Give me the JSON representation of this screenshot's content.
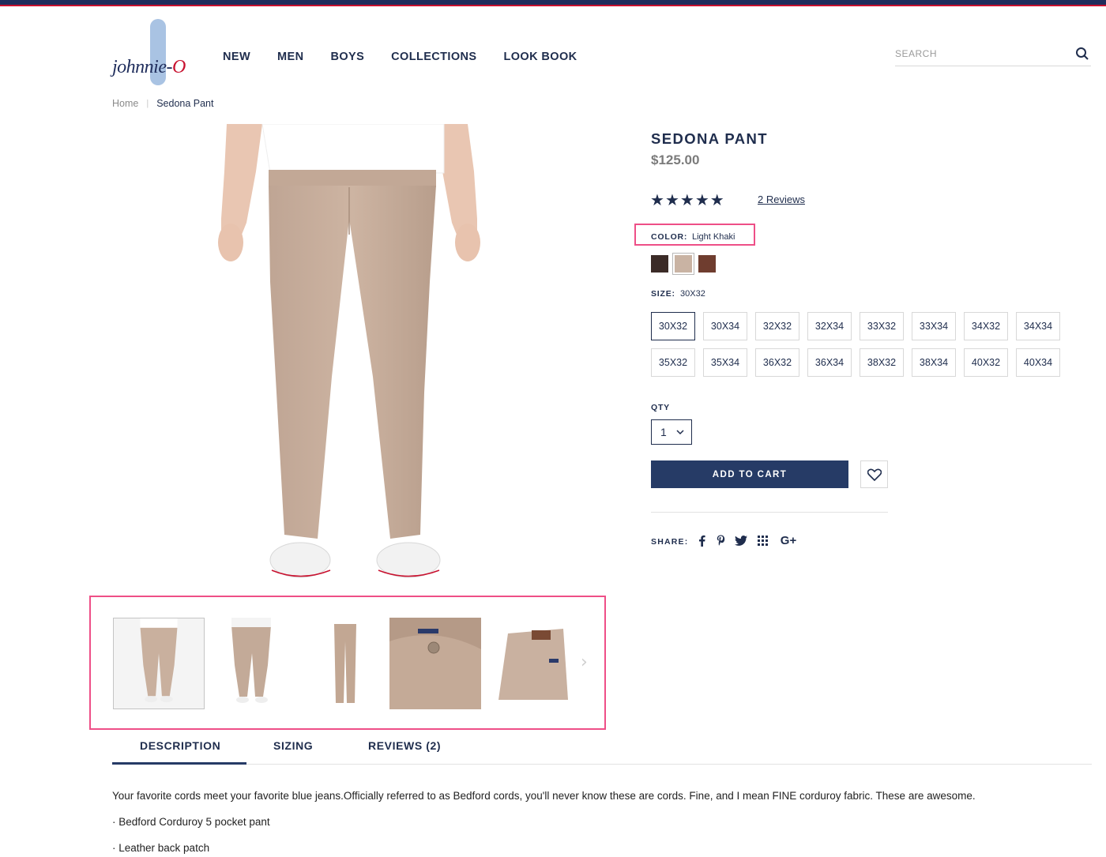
{
  "brand": {
    "logo_text_main": "johnnie-",
    "logo_text_accent": "O"
  },
  "nav": {
    "items": [
      "NEW",
      "MEN",
      "BOYS",
      "COLLECTIONS",
      "LOOK BOOK"
    ]
  },
  "search": {
    "placeholder": "SEARCH",
    "icon": "magnifier-icon"
  },
  "breadcrumb": {
    "home": "Home",
    "separator": "|",
    "current": "Sedona Pant"
  },
  "product": {
    "title": "SEDONA PANT",
    "price": "$125.00",
    "rating": {
      "stars": 5,
      "max": 5,
      "reviews_label": "2 Reviews"
    },
    "color": {
      "label": "COLOR:",
      "value": "Light Khaki",
      "swatches": [
        "#3b2b27",
        "#c9b3a3",
        "#6f3d2f"
      ],
      "selected_index": 1
    },
    "size": {
      "label": "SIZE:",
      "value": "30X32",
      "options": [
        "30X32",
        "30X34",
        "32X32",
        "32X34",
        "33X32",
        "33X34",
        "34X32",
        "34X34",
        "35X32",
        "35X34",
        "36X32",
        "36X34",
        "38X32",
        "38X34",
        "40X32",
        "40X34"
      ],
      "selected": "30X32"
    },
    "qty": {
      "label": "QTY",
      "value": "1"
    },
    "add_to_cart": "ADD TO CART",
    "wishlist_icon": "heart-icon",
    "share": {
      "label": "SHARE:",
      "icons": [
        "facebook-icon",
        "pinterest-icon",
        "twitter-icon",
        "grid-share-icon",
        "google-plus-icon"
      ]
    }
  },
  "gallery": {
    "thumbnails": [
      "front-view",
      "front-view-2",
      "flat-full",
      "detail-pocket",
      "folded"
    ],
    "active_index": 0
  },
  "tabs": {
    "items": [
      "DESCRIPTION",
      "SIZING",
      "REVIEWS (2)"
    ],
    "active_index": 0
  },
  "description": {
    "text": "Your favorite cords meet your favorite blue jeans.Officially referred to as Bedford cords, you'll never know these are cords. Fine, and I mean FINE corduroy fabric. These are awesome.",
    "bullets": [
      "· Bedford Corduroy 5 pocket pant",
      "· Leather back patch"
    ]
  },
  "colors": {
    "navy": "#1f2d4d",
    "button": "#263b66",
    "highlight": "#ee4f87",
    "khaki": "#c9b3a3"
  }
}
